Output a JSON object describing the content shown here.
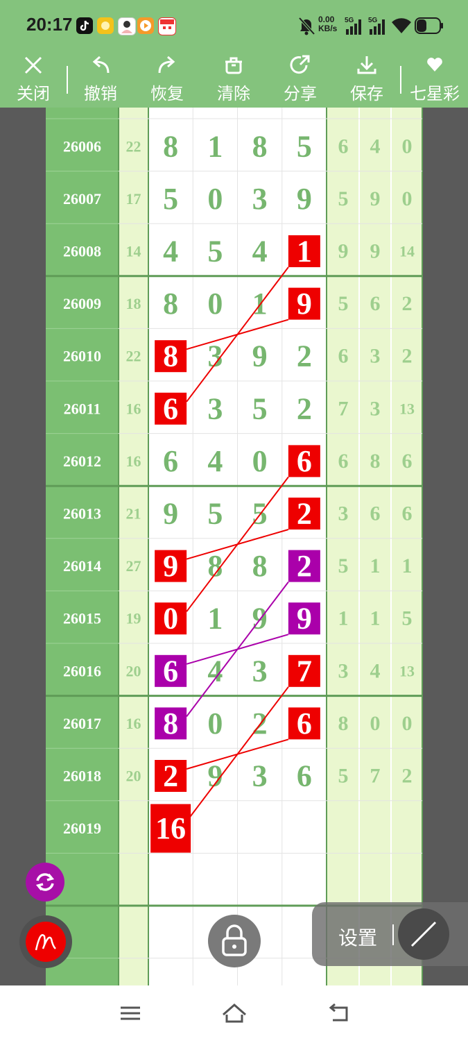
{
  "status_bar": {
    "time": "20:17",
    "net_speed_value": "0.00",
    "net_speed_unit": "KB/s",
    "sim1": "5G",
    "sim2": "5G",
    "icons": [
      "tiktok-icon",
      "sun-app-icon",
      "avatar-app-icon",
      "video-app-icon",
      "calendar-app-icon",
      "mute-icon",
      "signal-icon",
      "signal-icon",
      "wifi-icon",
      "battery-icon"
    ]
  },
  "toolbar": {
    "items": [
      {
        "label": "关闭",
        "icon": "close-icon"
      },
      {
        "label": "撤销",
        "icon": "undo-icon"
      },
      {
        "label": "恢复",
        "icon": "redo-icon"
      },
      {
        "label": "清除",
        "icon": "trash-icon"
      },
      {
        "label": "分享",
        "icon": "share-icon"
      },
      {
        "label": "保存",
        "icon": "download-icon"
      },
      {
        "label": "七星彩",
        "icon": "heart-icon"
      }
    ]
  },
  "table": {
    "rows": [
      {
        "issue": "26006",
        "sum": "22",
        "digits": [
          "8",
          "1",
          "8",
          "5"
        ],
        "right": [
          "6",
          "4",
          "0"
        ]
      },
      {
        "issue": "26007",
        "sum": "17",
        "digits": [
          "5",
          "0",
          "3",
          "9"
        ],
        "right": [
          "5",
          "9",
          "0"
        ]
      },
      {
        "issue": "26008",
        "sum": "14",
        "digits": [
          "4",
          "5",
          "4",
          "1"
        ],
        "right": [
          "9",
          "9",
          "14"
        ]
      },
      {
        "issue": "26009",
        "sum": "18",
        "digits": [
          "8",
          "0",
          "1",
          "9"
        ],
        "right": [
          "5",
          "6",
          "2"
        ]
      },
      {
        "issue": "26010",
        "sum": "22",
        "digits": [
          "8",
          "3",
          "9",
          "2"
        ],
        "right": [
          "6",
          "3",
          "2"
        ]
      },
      {
        "issue": "26011",
        "sum": "16",
        "digits": [
          "6",
          "3",
          "5",
          "2"
        ],
        "right": [
          "7",
          "3",
          "13"
        ]
      },
      {
        "issue": "26012",
        "sum": "16",
        "digits": [
          "6",
          "4",
          "0",
          "6"
        ],
        "right": [
          "6",
          "8",
          "6"
        ]
      },
      {
        "issue": "26013",
        "sum": "21",
        "digits": [
          "9",
          "5",
          "5",
          "2"
        ],
        "right": [
          "3",
          "6",
          "6"
        ]
      },
      {
        "issue": "26014",
        "sum": "27",
        "digits": [
          "9",
          "8",
          "8",
          "2"
        ],
        "right": [
          "5",
          "1",
          "1"
        ]
      },
      {
        "issue": "26015",
        "sum": "19",
        "digits": [
          "0",
          "1",
          "9",
          "9"
        ],
        "right": [
          "1",
          "1",
          "5"
        ]
      },
      {
        "issue": "26016",
        "sum": "20",
        "digits": [
          "6",
          "4",
          "3",
          "7"
        ],
        "right": [
          "3",
          "4",
          "13"
        ]
      },
      {
        "issue": "26017",
        "sum": "16",
        "digits": [
          "8",
          "0",
          "2",
          "6"
        ],
        "right": [
          "8",
          "0",
          "0"
        ]
      },
      {
        "issue": "26018",
        "sum": "20",
        "digits": [
          "2",
          "9",
          "3",
          "6"
        ],
        "right": [
          "5",
          "7",
          "2"
        ]
      },
      {
        "issue": "26019",
        "sum": "",
        "digits": [
          "16",
          "",
          "",
          ""
        ],
        "right": [
          "",
          "",
          ""
        ]
      }
    ],
    "marks": [
      {
        "row": 2,
        "col": 3,
        "color": "red"
      },
      {
        "row": 3,
        "col": 3,
        "color": "red"
      },
      {
        "row": 4,
        "col": 0,
        "color": "red"
      },
      {
        "row": 5,
        "col": 0,
        "color": "red"
      },
      {
        "row": 6,
        "col": 3,
        "color": "red"
      },
      {
        "row": 7,
        "col": 3,
        "color": "red"
      },
      {
        "row": 8,
        "col": 0,
        "color": "red"
      },
      {
        "row": 9,
        "col": 0,
        "color": "red"
      },
      {
        "row": 8,
        "col": 3,
        "color": "purple"
      },
      {
        "row": 9,
        "col": 3,
        "color": "purple"
      },
      {
        "row": 10,
        "col": 0,
        "color": "purple"
      },
      {
        "row": 11,
        "col": 0,
        "color": "purple"
      },
      {
        "row": 10,
        "col": 3,
        "color": "red"
      },
      {
        "row": 11,
        "col": 3,
        "color": "red"
      },
      {
        "row": 12,
        "col": 0,
        "color": "red"
      },
      {
        "row": 13,
        "col": 0,
        "color": "red"
      }
    ],
    "lines": [
      {
        "from": [
          2,
          3
        ],
        "to": [
          5,
          0
        ],
        "color": "red"
      },
      {
        "from": [
          3,
          3
        ],
        "to": [
          4,
          0
        ],
        "color": "red"
      },
      {
        "from": [
          6,
          3
        ],
        "to": [
          9,
          0
        ],
        "color": "red"
      },
      {
        "from": [
          7,
          3
        ],
        "to": [
          8,
          0
        ],
        "color": "red"
      },
      {
        "from": [
          8,
          3
        ],
        "to": [
          11,
          0
        ],
        "color": "purple"
      },
      {
        "from": [
          9,
          3
        ],
        "to": [
          10,
          0
        ],
        "color": "purple"
      },
      {
        "from": [
          10,
          3
        ],
        "to": [
          13,
          0
        ],
        "color": "red"
      },
      {
        "from": [
          11,
          3
        ],
        "to": [
          12,
          0
        ],
        "color": "red"
      }
    ]
  },
  "colors": {
    "header_green": "#84c37d",
    "issue_col": "#7bbf72",
    "digit_green": "#77b66f",
    "light_green": "#eaf7cf",
    "grey_side": "#5a5a5a",
    "mark_red": "#ee0000",
    "mark_purple": "#aa00aa"
  },
  "settings": {
    "label": "设置"
  },
  "fabs": [
    {
      "name": "refresh-button",
      "icon": "refresh-icon",
      "color": "#a70fa7"
    },
    {
      "name": "pen-button",
      "icon": "pen-icon",
      "color": "#ee0000"
    },
    {
      "name": "lock-button",
      "icon": "lock-icon",
      "color": "#777777"
    },
    {
      "name": "line-tool-button",
      "icon": "line-icon",
      "color": "#4a4a4a"
    }
  ],
  "nav": [
    "menu-icon",
    "home-icon",
    "back-icon"
  ]
}
